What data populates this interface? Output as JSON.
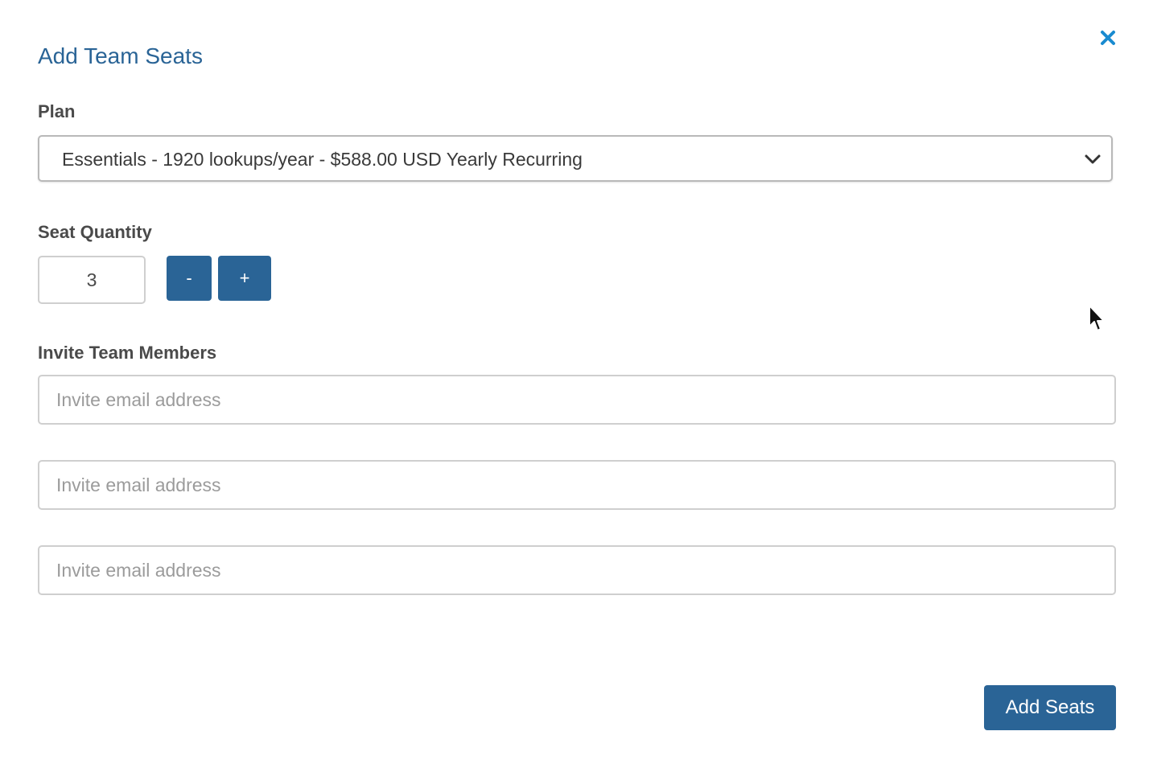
{
  "modal": {
    "title": "Add Team Seats",
    "close_icon": "close-icon"
  },
  "plan": {
    "label": "Plan",
    "selected": "Essentials - 1920 lookups/year - $588.00 USD Yearly Recurring",
    "chevron_icon": "chevron-down-icon"
  },
  "seats": {
    "label": "Seat Quantity",
    "value": "3",
    "decrement_label": "-",
    "increment_label": "+"
  },
  "invite": {
    "label": "Invite Team Members",
    "fields": [
      {
        "placeholder": "Invite email address",
        "value": ""
      },
      {
        "placeholder": "Invite email address",
        "value": ""
      },
      {
        "placeholder": "Invite email address",
        "value": ""
      }
    ]
  },
  "actions": {
    "submit_label": "Add Seats"
  },
  "colors": {
    "accent": "#2a6496",
    "close": "#1a8bd0",
    "label": "#4a4a4a",
    "border": "#cfcfcf"
  }
}
